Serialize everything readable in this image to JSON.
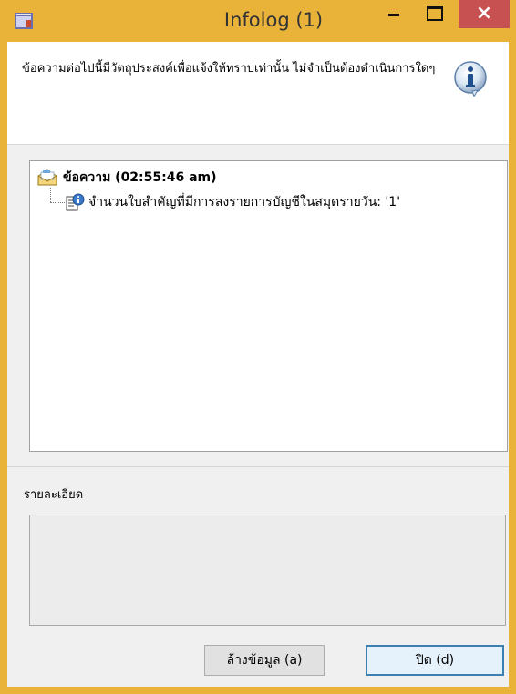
{
  "window": {
    "title": "Infolog (1)",
    "close_glyph": "×"
  },
  "message": {
    "text": "ข้อความต่อไปนี้มีวัตถุประสงค์เพื่อแจ้งให้ทราบเท่านั้น ไม่จำเป็นต้องดำเนินการใดๆ",
    "icon": "info-icon"
  },
  "tree": {
    "root": {
      "icon": "message-envelope-icon",
      "label": "ข้อความ (02:55:46 am)"
    },
    "child": {
      "icon": "info-document-icon",
      "label": "จำนวนใบสำคัญที่มีการลงรายการบัญชีในสมุดรายวัน: '1'"
    }
  },
  "details": {
    "label": "รายละเอียด",
    "value": ""
  },
  "buttons": {
    "clear": "ล้างข้อมูล (a)",
    "close": "ปิด (d)"
  },
  "colors": {
    "titlebar": "#e9b33a",
    "close_button": "#c75050",
    "default_button_border": "#3c7fb1"
  }
}
